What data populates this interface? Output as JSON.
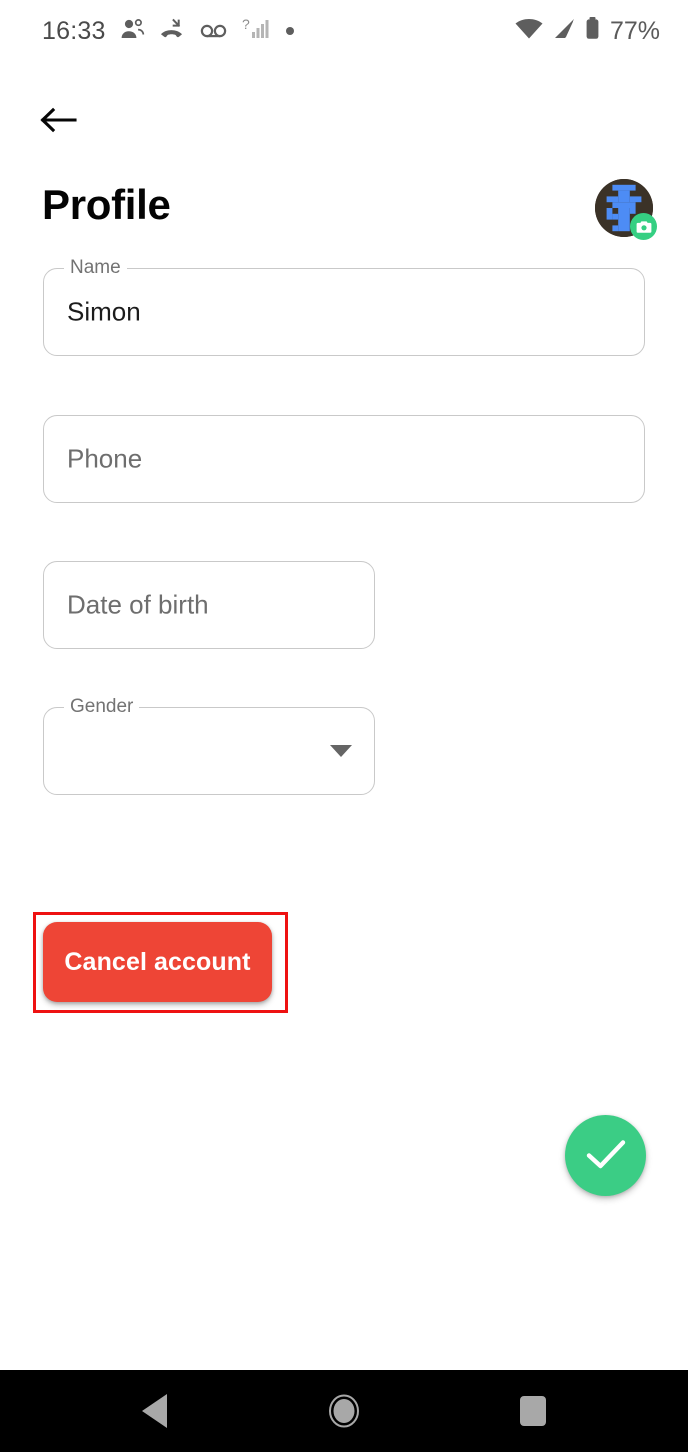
{
  "status_bar": {
    "clock": "16:33",
    "battery_percent": "77%",
    "left_icons": [
      "people-group-icon",
      "missed-call-icon",
      "voicemail-icon",
      "signal-unknown-icon",
      "dot-icon"
    ],
    "right_icons": [
      "wifi-icon",
      "cellular-signal-icon",
      "battery-icon"
    ]
  },
  "app_bar": {
    "back_icon": "back-arrow-icon",
    "title": "Profile",
    "avatar_icon": "avatar-identicon",
    "camera_badge_icon": "camera-icon"
  },
  "form": {
    "fields": [
      {
        "name": "name",
        "label": "Name",
        "value": "Simon",
        "placeholder": "",
        "type": "text",
        "label_floating": true
      },
      {
        "name": "phone",
        "label": "Phone",
        "value": "",
        "placeholder": "Phone",
        "type": "tel",
        "label_floating": false
      },
      {
        "name": "dob",
        "label": "Date of birth",
        "value": "",
        "placeholder": "Date of birth",
        "type": "date",
        "label_floating": false
      },
      {
        "name": "gender",
        "label": "Gender",
        "value": "",
        "placeholder": "",
        "type": "dropdown",
        "label_floating": true
      }
    ],
    "dropdown_icon": "chevron-down-icon"
  },
  "actions": {
    "cancel_account_label": "Cancel account",
    "cancel_account_color": "#ee4536",
    "save_fab_icon": "check-icon",
    "save_fab_color": "#3bcd85",
    "annotation_color": "#ee1111"
  },
  "nav_bar": {
    "back_icon": "nav-back-triangle-icon",
    "home_icon": "nav-home-circle-icon",
    "recents_icon": "nav-recents-square-icon"
  }
}
